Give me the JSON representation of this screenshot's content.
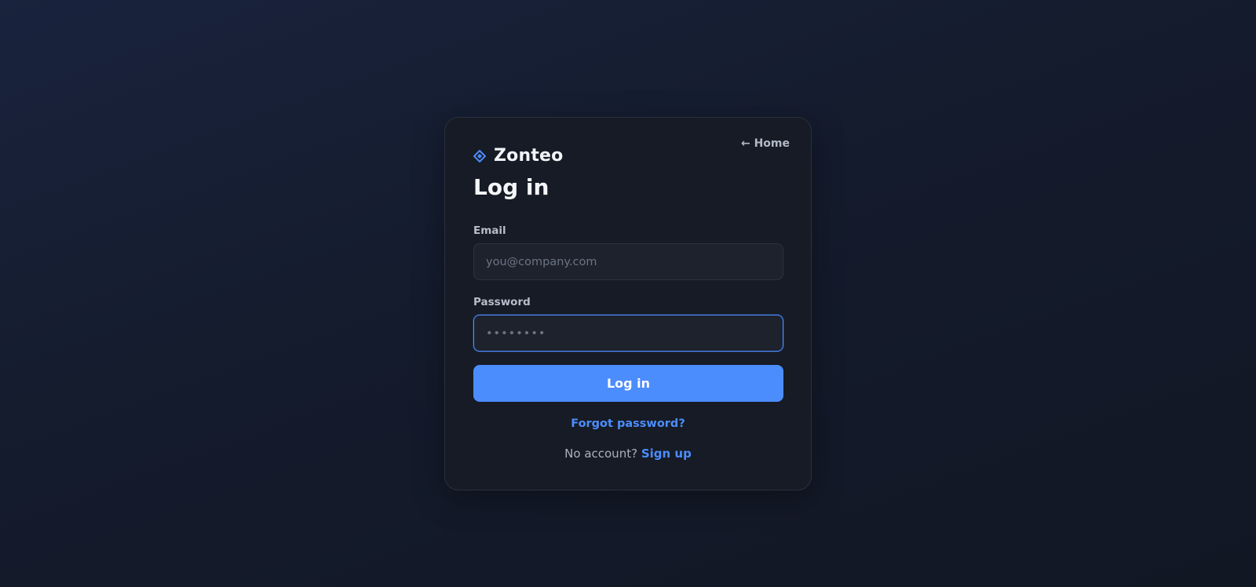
{
  "nav": {
    "home_label": "← Home"
  },
  "brand": {
    "name": "Zonteo",
    "icon": "diamond-logo-icon",
    "accent_color": "#4c8dfd"
  },
  "form": {
    "title": "Log in",
    "email": {
      "label": "Email",
      "placeholder": "you@company.com",
      "value": ""
    },
    "password": {
      "label": "Password",
      "placeholder": "••••••••",
      "value": ""
    },
    "submit_label": "Log in",
    "forgot_label": "Forgot password?",
    "signup_prompt": "No account?",
    "signup_label": "Sign up"
  }
}
